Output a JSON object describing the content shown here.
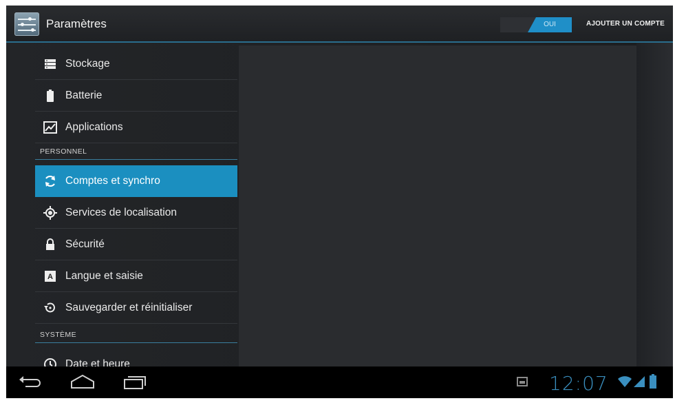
{
  "actionbar": {
    "title": "Paramètres",
    "toggle_label": "OUI",
    "add_account": "AJOUTER UN COMPTE",
    "icon": "settings-sliders-icon"
  },
  "sidebar": {
    "items": [
      {
        "label": "Stockage",
        "icon": "storage-icon"
      },
      {
        "label": "Batterie",
        "icon": "battery-icon"
      },
      {
        "label": "Applications",
        "icon": "applications-icon"
      },
      {
        "label": "Comptes et synchro",
        "icon": "sync-icon",
        "selected": true
      },
      {
        "label": "Services de localisation",
        "icon": "location-icon"
      },
      {
        "label": "Sécurité",
        "icon": "lock-icon"
      },
      {
        "label": "Langue et saisie",
        "icon": "language-icon"
      },
      {
        "label": "Sauvegarder et réinitialiser",
        "icon": "backup-reset-icon"
      },
      {
        "label": "Date et heure",
        "icon": "clock-icon"
      }
    ],
    "sections": {
      "personnel": "PERSONNEL",
      "systeme": "SYSTÈME"
    }
  },
  "statusbar": {
    "time": "12:07",
    "icons": [
      "back-icon",
      "home-icon",
      "recent-apps-icon",
      "screenshot-icon",
      "wifi-icon",
      "signal-icon",
      "battery-status-icon"
    ]
  },
  "colors": {
    "accent": "#1b8fc0",
    "clock": "#3a8fbf",
    "background": "#1d1f22"
  }
}
